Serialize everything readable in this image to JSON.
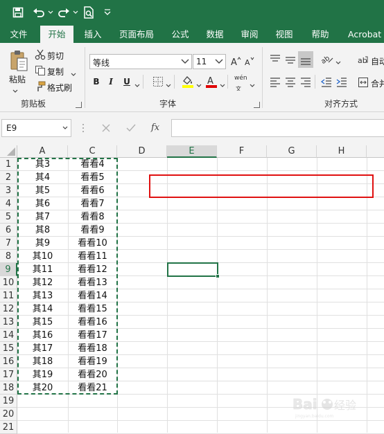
{
  "quick_access": {
    "save_icon": "save-icon",
    "undo_icon": "undo-icon",
    "redo_icon": "redo-icon",
    "print_preview_icon": "print-preview-icon",
    "customize_icon": "customize-toolbar-icon"
  },
  "tabs": [
    "文件",
    "开始",
    "插入",
    "页面布局",
    "公式",
    "数据",
    "审阅",
    "视图",
    "帮助",
    "Acrobat"
  ],
  "active_tab": "开始",
  "clipboard": {
    "paste_label": "粘贴",
    "cut_label": "剪切",
    "copy_label": "复制",
    "format_painter_label": "格式刷",
    "group_label": "剪贴板"
  },
  "font": {
    "font_name": "等线",
    "font_size": "11",
    "bold": "B",
    "italic": "I",
    "underline": "U",
    "phonetic": "wén",
    "group_label": "字体"
  },
  "alignment": {
    "wrap_label": "自动",
    "merge_label": "合并",
    "group_label": "对齐方式"
  },
  "formula_bar": {
    "name_box": "E9",
    "fx_label": "fx",
    "formula": ""
  },
  "grid": {
    "columns": [
      "A",
      "C",
      "D",
      "E",
      "F",
      "G",
      "H"
    ],
    "selected_column": "E",
    "rows": [
      "1",
      "2",
      "3",
      "4",
      "5",
      "6",
      "7",
      "8",
      "9",
      "10",
      "11",
      "12",
      "13",
      "14",
      "15",
      "16",
      "17",
      "18",
      "19",
      "20",
      "21"
    ],
    "selected_row": "9",
    "col_A": [
      "其3",
      "其4",
      "其5",
      "其6",
      "其7",
      "其8",
      "其9",
      "其10",
      "其11",
      "其12",
      "其13",
      "其14",
      "其15",
      "其16",
      "其17",
      "其18",
      "其19",
      "其20"
    ],
    "col_C": [
      "看看4",
      "看看5",
      "看看6",
      "看看7",
      "看看8",
      "看看9",
      "看看10",
      "看看11",
      "看看12",
      "看看13",
      "看看14",
      "看看15",
      "看看16",
      "看看17",
      "看看18",
      "看看19",
      "看看20",
      "看看21"
    ]
  },
  "colors": {
    "excel_green": "#217346",
    "highlight_yellow": "#ffff00",
    "font_red": "#e00000",
    "annotation_red": "#e01010",
    "copy_marquee": "#217346"
  },
  "watermark": "Baidu 经验"
}
